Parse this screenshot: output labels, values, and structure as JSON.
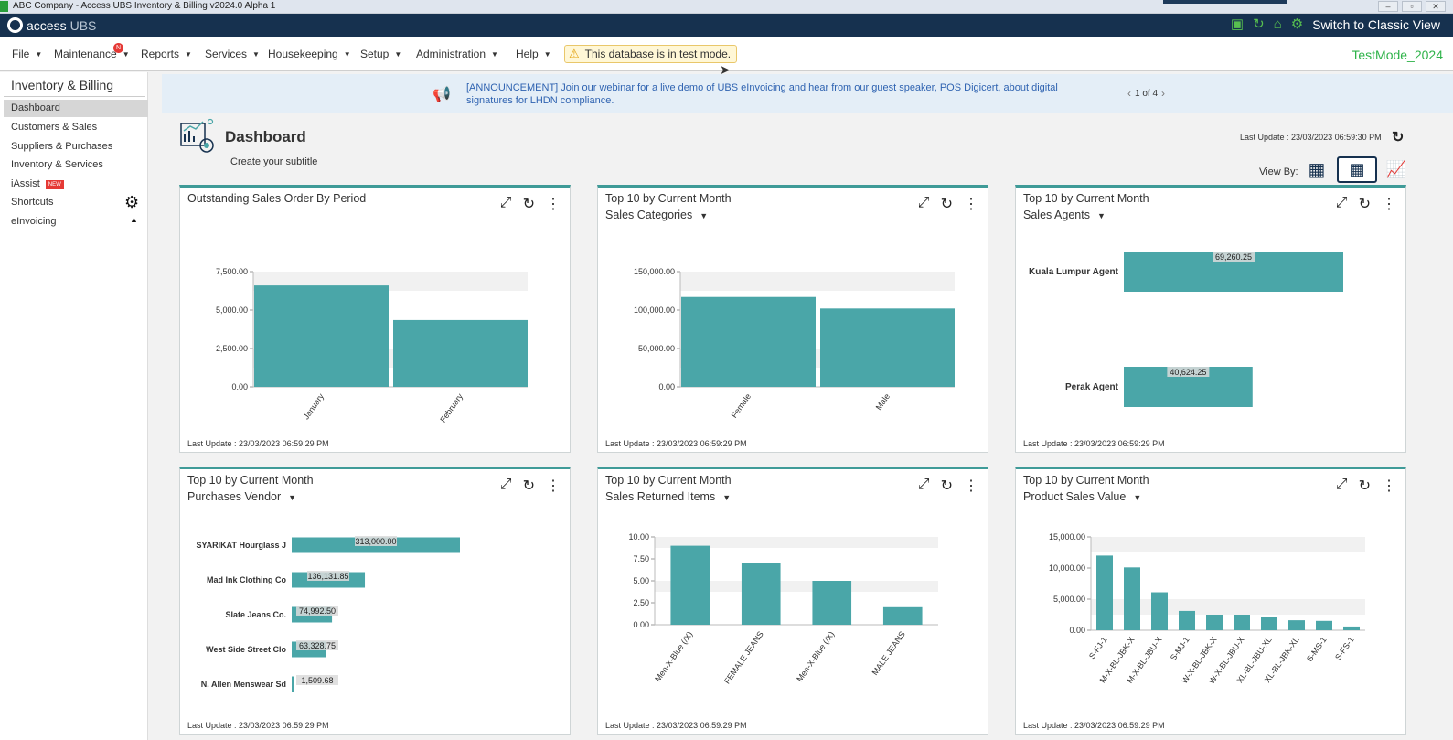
{
  "window": {
    "title": "ABC Company - Access UBS Inventory & Billing v2024.0 Alpha 1",
    "controls": [
      "–",
      "▫",
      "✕"
    ]
  },
  "brand": {
    "prefix": "access",
    "suffix": "UBS"
  },
  "topbar": {
    "switch_label": "Switch to Classic View"
  },
  "menu": {
    "items": [
      "File",
      "Maintenance",
      "Reports",
      "Services",
      "Housekeeping",
      "Setup",
      "Administration",
      "Help"
    ],
    "maintenance_badge": "N",
    "test_notice": "This database is in test mode.",
    "mode_label": "TestMode_2024"
  },
  "sidebar": {
    "title": "Inventory & Billing",
    "items": [
      {
        "label": "Dashboard"
      },
      {
        "label": "Customers & Sales"
      },
      {
        "label": "Suppliers & Purchases"
      },
      {
        "label": "Inventory & Services"
      },
      {
        "label": "iAssist",
        "badge": "NEW"
      },
      {
        "label": "Shortcuts"
      },
      {
        "label": "eInvoicing"
      }
    ]
  },
  "announcement": {
    "text": "[ANNOUNCEMENT] Join our webinar for a live demo of UBS eInvoicing and hear from our guest speaker, POS Digicert, about digital signatures for LHDN compliance.",
    "pager": "1 of 4"
  },
  "dashboard": {
    "title": "Dashboard",
    "subtitle": "Create your subtitle",
    "last_update": "Last Update : 23/03/2023 06:59:30 PM",
    "view_by_label": "View By:"
  },
  "colors": {
    "bar": "#4aa6a8",
    "accent": "#3f9b98",
    "navy": "#16314f",
    "testmode": "#2fb34a"
  },
  "panels": [
    {
      "title": "Outstanding Sales Order By Period",
      "subtitle": "",
      "footer": "Last Update : 23/03/2023 06:59:29 PM",
      "chart_data": {
        "type": "bar",
        "categories": [
          "January",
          "February"
        ],
        "values": [
          6600,
          4350
        ],
        "ylim": [
          0,
          7500
        ],
        "yticks": [
          "0.00",
          "2,500.00",
          "5,000.00",
          "7,500.00"
        ]
      }
    },
    {
      "title": "Top 10 by Current Month",
      "subtitle": "Sales Categories",
      "footer": "Last Update : 23/03/2023 06:59:29 PM",
      "chart_data": {
        "type": "bar",
        "categories": [
          "Female",
          "Male"
        ],
        "values": [
          117000,
          102000
        ],
        "ylim": [
          0,
          150000
        ],
        "yticks": [
          "0.00",
          "50,000.00",
          "100,000.00",
          "150,000.00"
        ]
      }
    },
    {
      "title": "Top 10 by Current Month",
      "subtitle": "Sales Agents",
      "footer": "Last Update : 23/03/2023 06:59:29 PM",
      "chart_data": {
        "type": "bar",
        "orientation": "horizontal",
        "categories": [
          "Kuala Lumpur Agent",
          "Perak Agent"
        ],
        "values": [
          69260.25,
          40624.25
        ],
        "labels": [
          "69,260.25",
          "40,624.25"
        ]
      }
    },
    {
      "title": "Top 10 by Current Month",
      "subtitle": "Purchases Vendor",
      "footer": "Last Update : 23/03/2023 06:59:29 PM",
      "chart_data": {
        "type": "bar",
        "orientation": "horizontal",
        "categories": [
          "SYARIKAT Hourglass J",
          "Mad Ink Clothing Co",
          "Slate Jeans Co.",
          "West Side Street Clo",
          "N. Allen Menswear Sd"
        ],
        "values": [
          313000.0,
          136131.85,
          74992.5,
          63328.75,
          1509.68
        ],
        "labels": [
          "313,000.00",
          "136,131.85",
          "74,992.50",
          "63,328.75",
          "1,509.68"
        ]
      }
    },
    {
      "title": "Top 10 by Current Month",
      "subtitle": "Sales Returned Items",
      "footer": "Last Update : 23/03/2023 06:59:29 PM",
      "chart_data": {
        "type": "bar",
        "categories": [
          "Men-X-Blue (/X)",
          "FEMALE JEANS",
          "Men-X-Blue (/X)",
          "MALE JEANS"
        ],
        "values": [
          9,
          7,
          5,
          2
        ],
        "ylim": [
          0,
          10
        ],
        "yticks": [
          "0.00",
          "2.50",
          "5.00",
          "7.50",
          "10.00"
        ]
      }
    },
    {
      "title": "Top 10 by Current Month",
      "subtitle": "Product Sales Value",
      "footer": "Last Update : 23/03/2023 06:59:29 PM",
      "chart_data": {
        "type": "bar",
        "categories": [
          "S-FJ-1",
          "M-X-BL-JBK-X",
          "M-X-BL-JBU-X",
          "S-MJ-1",
          "W-X-BL-JBK-X",
          "W-X-BL-JBU-X",
          "XL-BL-JBU-XL",
          "XL-BL-JBK-XL",
          "S-MS-1",
          "S-FS-1"
        ],
        "values": [
          12000,
          10100,
          6100,
          3100,
          2500,
          2500,
          2200,
          1600,
          1500,
          600
        ],
        "ylim": [
          0,
          15000
        ],
        "yticks": [
          "0.00",
          "5,000.00",
          "10,000.00",
          "15,000.00"
        ]
      }
    }
  ]
}
